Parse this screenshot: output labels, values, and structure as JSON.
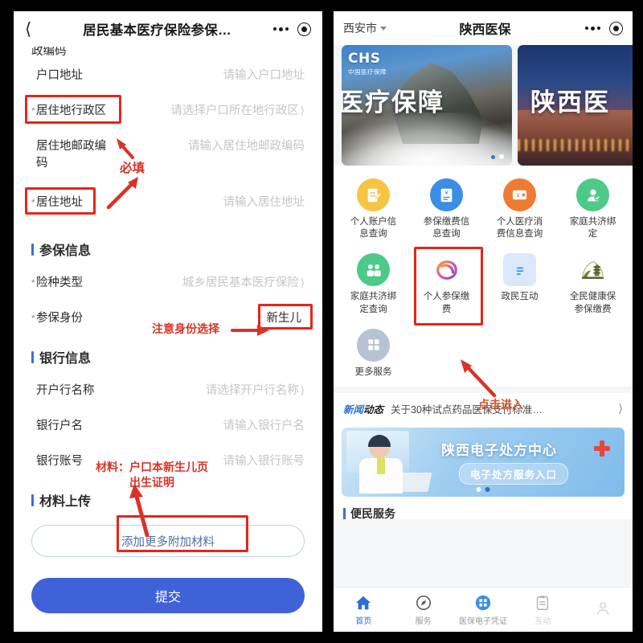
{
  "left_phone": {
    "navbar": {
      "back_icon": "chevron-left-icon",
      "title": "居民基本医疗保险参保…",
      "more_icon": "more-dots-icon",
      "capsule_icon": "target-circle-icon"
    },
    "cut_off_text": "政编码",
    "fields": [
      {
        "label": "户口地址",
        "value": "请输入户口地址",
        "required": false,
        "chevron": false,
        "highlight": false
      },
      {
        "label": "居住地行政区",
        "value": "请选择户口所在地行政区",
        "required": true,
        "chevron": true,
        "highlight": true
      },
      {
        "label": "居住地邮政编\n码",
        "value": "请输入居住地邮政编码",
        "required": false,
        "chevron": false,
        "highlight": false
      },
      {
        "label": "居住地址",
        "value": "请输入居住地址",
        "required": true,
        "chevron": false,
        "highlight": true
      }
    ],
    "section_insurance": {
      "title": "参保信息",
      "fields": [
        {
          "label": "险种类型",
          "value": "城乡居民基本医疗保险",
          "required": true,
          "chevron": true,
          "highlight": false
        },
        {
          "label": "参保身份",
          "value": "新生儿",
          "required": true,
          "chevron": false,
          "highlight": true
        }
      ]
    },
    "section_bank": {
      "title": "银行信息",
      "fields": [
        {
          "label": "开户行名称",
          "value": "请选择开户行名称",
          "required": false,
          "chevron": true,
          "highlight": false
        },
        {
          "label": "银行户名",
          "value": "请输入银行户名",
          "required": false,
          "chevron": false,
          "highlight": false
        },
        {
          "label": "银行账号",
          "value": "请输入银行账号",
          "required": false,
          "chevron": false,
          "highlight": false
        }
      ]
    },
    "section_upload": {
      "title": "材料上传",
      "add_button": "添加更多附加材料"
    },
    "submit_button": "提交",
    "annotations": [
      {
        "text": "必填",
        "note": "required-fields-annotation"
      },
      {
        "text": "注意身份选择",
        "note": "identity-choice-annotation"
      },
      {
        "text": "材料：户口本新生儿页\n出生证明",
        "note": "materials-annotation"
      }
    ]
  },
  "right_phone": {
    "navbar": {
      "city": "西安市",
      "city_caret_icon": "caret-down-icon",
      "title": "陕西医保",
      "more_icon": "more-dots-icon",
      "capsule_icon": "target-circle-icon"
    },
    "banners": [
      {
        "logo_mark": "CHS",
        "logo_sub": "中国医疗保障",
        "headline": "医疗保障"
      },
      {
        "headline": "陕西医"
      }
    ],
    "grid_items": [
      {
        "label": "个人账户信\n息查询",
        "icon": "account-edit-icon",
        "color": "#f5c542",
        "highlight": false
      },
      {
        "label": "参保缴费信\n息查询",
        "icon": "payment-doc-icon",
        "color": "#3a8ee6",
        "highlight": false
      },
      {
        "label": "个人医疗消\n费信息查询",
        "icon": "wallet-card-icon",
        "color": "#ee7b33",
        "highlight": false
      },
      {
        "label": "家庭共济绑\n定",
        "icon": "person-check-icon",
        "color": "#4ec98a",
        "highlight": false
      },
      {
        "label": "家庭共济绑\n定查询",
        "icon": "two-people-icon",
        "color": "#4ec98a",
        "highlight": false
      },
      {
        "label": "个人参保缴\n费",
        "icon": "ribbon-loop-icon",
        "color": "#e8558f",
        "highlight": true
      },
      {
        "label": "政民互动",
        "icon": "list-lines-icon",
        "color": "#3a8ee6",
        "highlight": false
      },
      {
        "label": "全民健康保\n参保缴费",
        "icon": "pagoda-icon",
        "color": "#7a8c3a",
        "highlight": false
      },
      {
        "label": "更多服务",
        "icon": "grid-squares-icon",
        "color": "#b7c2d4",
        "highlight": false
      }
    ],
    "news": {
      "tag_part1": "新闻",
      "tag_part2": "动态",
      "headline": "关于30种试点药品医保支付标准…",
      "chevron_icon": "chevron-right-icon"
    },
    "promo": {
      "title": "陕西电子处方中心",
      "pill": "电子处方服务入口",
      "cross_icon": "medical-cross-icon",
      "doctor_icon": "doctor-illustration"
    },
    "partial_section_title": "便民服务",
    "tabbar": [
      {
        "label": "首页",
        "icon": "home-icon",
        "active": true
      },
      {
        "label": "服务",
        "icon": "compass-icon",
        "active": false
      },
      {
        "label": "医保电子凭证",
        "icon": "qr-code-icon",
        "active": false
      },
      {
        "label": "互动",
        "icon": "clipboard-icon",
        "active": false
      }
    ],
    "annotation": {
      "text": "点击进入",
      "note": "click-to-enter-annotation"
    }
  },
  "colors": {
    "accent_blue": "#3f62d8",
    "section_bar_blue": "#3f6ecb",
    "annotation_red": "#d93327",
    "highlight_box_red": "#e8241a",
    "placeholder_gray": "#c6c6c8"
  }
}
